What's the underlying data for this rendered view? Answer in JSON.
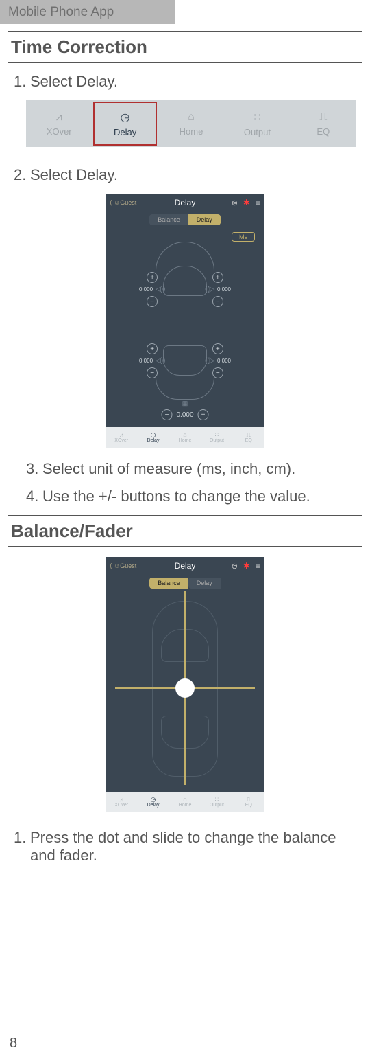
{
  "header_tab": "Mobile Phone App",
  "section1_title": "Time Correction",
  "step1": {
    "num": "1.",
    "text": "Select Delay."
  },
  "step2": {
    "num": "2.",
    "text": "Select Delay."
  },
  "step3": {
    "num": "3.",
    "text": "Select unit of measure (ms, inch, cm)."
  },
  "step4": {
    "num": "4.",
    "text": "Use the +/- buttons to change the value."
  },
  "section2_title": "Balance/Fader",
  "step_b1": {
    "num": "1.",
    "text": "Press the dot and slide to change the balance and fader."
  },
  "page_number": "8",
  "tabbar": {
    "items": [
      {
        "icon": "⩘",
        "label": "XOver"
      },
      {
        "icon": "◷",
        "label": "Delay"
      },
      {
        "icon": "⌂",
        "label": "Home"
      },
      {
        "icon": "∷",
        "label": "Output"
      },
      {
        "icon": "⎍",
        "label": "EQ"
      }
    ]
  },
  "app": {
    "header_back": "Guest",
    "header_title": "Delay",
    "pill_balance": "Balance",
    "pill_delay": "Delay",
    "unit_button": "Ms",
    "value": "0.000",
    "bottom_nav": {
      "items": [
        {
          "icon": "⩘",
          "label": "XOver"
        },
        {
          "icon": "◷",
          "label": "Delay"
        },
        {
          "icon": "⌂",
          "label": "Home"
        },
        {
          "icon": "∷",
          "label": "Output"
        },
        {
          "icon": "⎍",
          "label": "EQ"
        }
      ]
    }
  }
}
